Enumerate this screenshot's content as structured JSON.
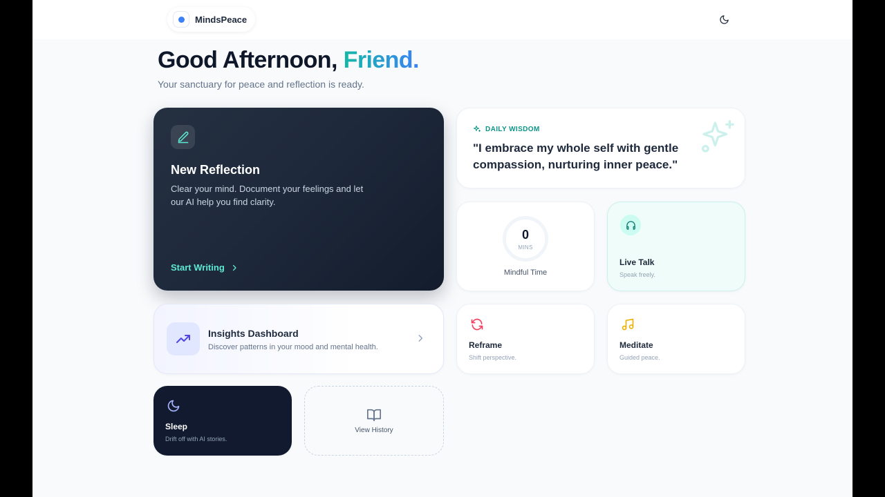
{
  "app": {
    "name": "MindsPeace"
  },
  "header": {
    "theme_icon": "moon-icon"
  },
  "greeting": {
    "prefix": "Good Afternoon, ",
    "name": "Friend.",
    "subtitle": "Your sanctuary for peace and reflection is ready."
  },
  "reflection": {
    "icon": "pen-icon",
    "title": "New Reflection",
    "description": "Clear your mind. Document your feelings and let our AI help you find clarity.",
    "cta": "Start Writing"
  },
  "wisdom": {
    "label": "DAILY WISDOM",
    "quote": "\"I embrace my whole self with gentle compassion, nurturing inner peace.\""
  },
  "mindful": {
    "value": "0",
    "unit": "MINS",
    "caption": "Mindful Time"
  },
  "tiles": {
    "live_talk": {
      "title": "Live Talk",
      "subtitle": "Speak freely.",
      "icon": "headphones-icon"
    },
    "reframe": {
      "title": "Reframe",
      "subtitle": "Shift perspective.",
      "icon": "refresh-icon"
    },
    "meditate": {
      "title": "Meditate",
      "subtitle": "Guided peace.",
      "icon": "music-note-icon"
    },
    "sleep": {
      "title": "Sleep",
      "subtitle": "Drift off with AI stories.",
      "icon": "moon-icon"
    }
  },
  "insights": {
    "title": "Insights Dashboard",
    "subtitle": "Discover patterns in your mood and mental health.",
    "icon": "trending-up-icon"
  },
  "history": {
    "label": "View History",
    "icon": "book-open-icon"
  },
  "colors": {
    "accent_teal": "#14b8a6",
    "accent_blue": "#3b82f6",
    "dark_card": "#1e293b",
    "reframe_red": "#f43f5e",
    "meditate_amber": "#eab308",
    "insights_indigo": "#4f46e5"
  }
}
